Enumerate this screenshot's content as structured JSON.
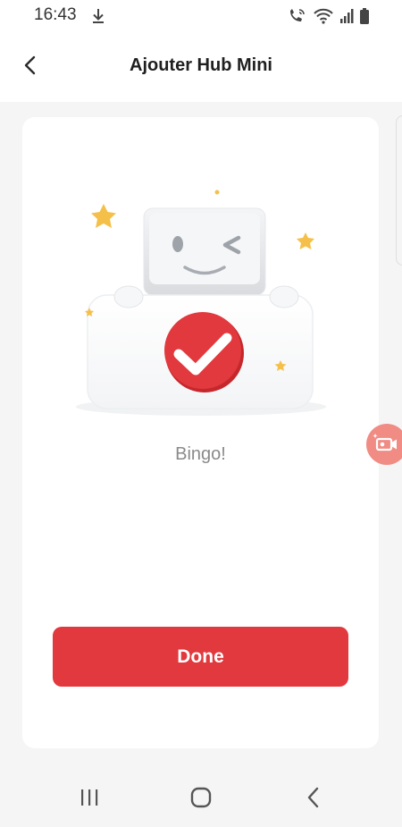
{
  "status_bar": {
    "time": "16:43",
    "icons": [
      "download-icon",
      "wifi-calling-icon",
      "wifi-icon",
      "signal-icon",
      "battery-icon"
    ]
  },
  "header": {
    "title": "Ajouter Hub Mini",
    "back_icon": "chevron-left-icon"
  },
  "main": {
    "illustration": "robot-with-checkmark-illustration",
    "message": "Bingo!",
    "done_label": "Done",
    "floating_icon": "screen-record-icon"
  },
  "navigation_bar": {
    "icons": [
      "recent-apps-icon",
      "home-icon",
      "back-icon"
    ]
  },
  "colors": {
    "accent": "#e1393d",
    "floating_button": "#f08c84",
    "background": "#f5f5f5",
    "card": "#ffffff",
    "star": "#f5c04a"
  }
}
